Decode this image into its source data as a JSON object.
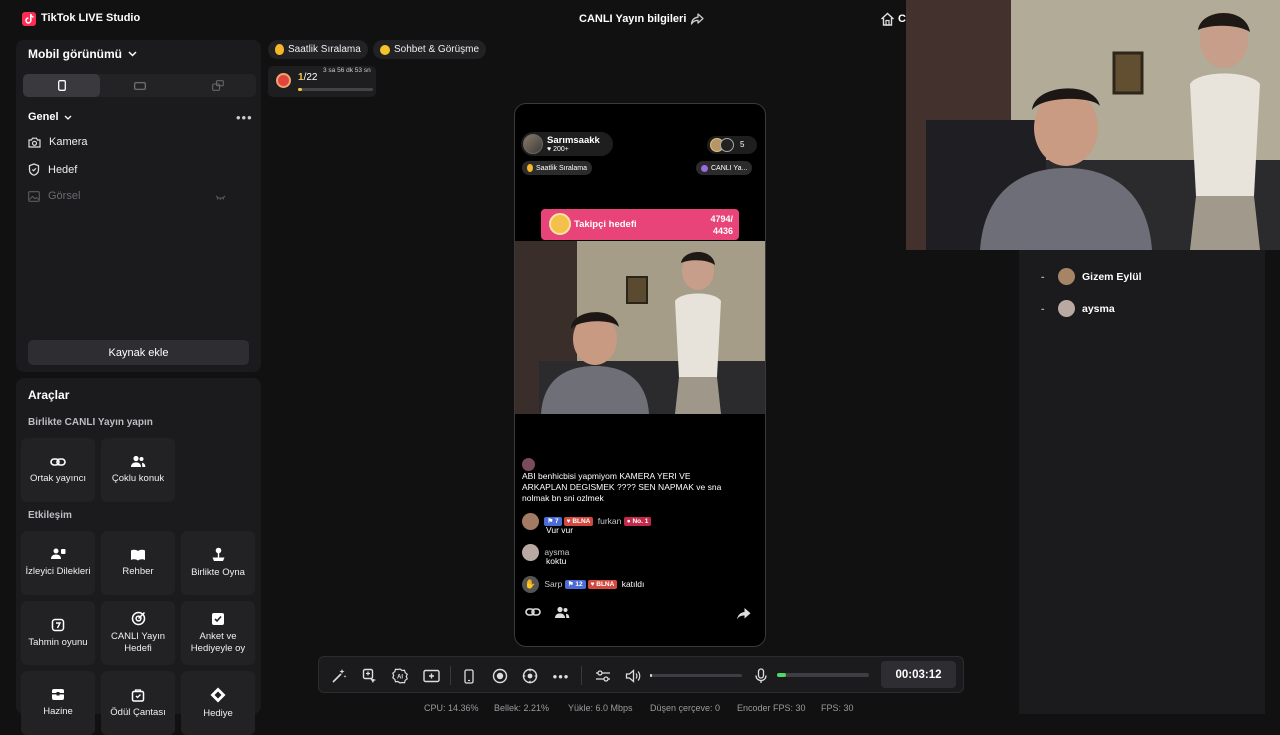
{
  "app": {
    "title": "TikTok LIVE Studio",
    "stream_info": "CANLI Yayın bilgileri",
    "home_label": "C"
  },
  "sources": {
    "view_mode": "Mobil görünümü",
    "section_label": "Genel",
    "items": [
      {
        "label": "Kamera",
        "icon": "camera-icon"
      },
      {
        "label": "Hedef",
        "icon": "shield-icon"
      },
      {
        "label": "Görsel",
        "icon": "image-icon"
      }
    ],
    "add_source": "Kaynak ekle"
  },
  "tools": {
    "title": "Araçlar",
    "together_label": "Birlikte CANLI Yayın yapın",
    "together_items": [
      "Ortak yayıncı",
      "Çoklu konuk"
    ],
    "interaction_label": "Etkileşim",
    "interaction_items": [
      "İzleyici Dilekleri",
      "Rehber",
      "Birlikte Oyna",
      "Tahmin oyunu",
      "CANLI Yayın Hedefi",
      "Anket ve Hediyeyle oy",
      "Hazine",
      "Ödül Çantası",
      "Hediye"
    ]
  },
  "top_chips": [
    "Saatlik Sıralama",
    "Sohbet & Görüşme"
  ],
  "ranking": {
    "position": "1",
    "total": "/22",
    "countdown": "3 sa 56 dk 53 sn",
    "progress": 0.05
  },
  "phone": {
    "host_name": "Sarımsaakk",
    "host_likes": "200+",
    "viewer_count": "5",
    "tag_left": "Saatlik Sıralama",
    "tag_right": "CANLI Ya...",
    "goal_label": "Takipçi hedefi",
    "goal_count": "4794/ 4436",
    "comments": [
      {
        "user": "",
        "text": "ABI benhicbisi yapmiyom KAMERA YERI VE ARKAPLAN DEGISMEK ???? SEN NAPMAK ve sna nolmak bn sni ozlmek"
      },
      {
        "user": "furkan",
        "level": "7",
        "club": "BLNA",
        "rank": "No. 1",
        "text": "Vur vur"
      },
      {
        "user": "aysma",
        "text": "koktu"
      },
      {
        "user": "Sarp",
        "level": "12",
        "club": "BLNA",
        "text": "katıldı"
      }
    ]
  },
  "guests": [
    {
      "name": "Gizem Eylül"
    },
    {
      "name": "aysma"
    }
  ],
  "controls": {
    "timer": "00:03:12",
    "volume": 0.02,
    "mic": 0.1
  },
  "status": {
    "cpu": "CPU: 14.36%",
    "memory": "Bellek: 2.21%",
    "upload": "Yükle: 6.0 Mbps",
    "dropped": "Düşen çerçeve: 0",
    "encoder": "Encoder FPS: 30",
    "fps": "FPS: 30"
  },
  "colors": {
    "accent": "#fe2c55",
    "goal": "#e8447a",
    "panel": "#1b1b1d",
    "mic_level": "#4cd964"
  }
}
